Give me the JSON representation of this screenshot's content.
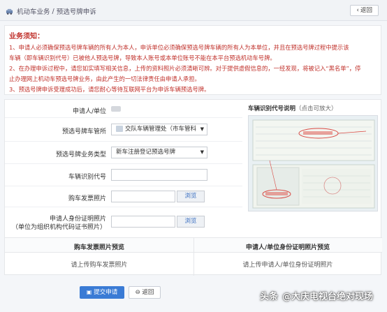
{
  "breadcrumb": {
    "section": "机动车业务",
    "separator": "/",
    "page": "预选号牌申诉"
  },
  "header": {
    "back_label": "返回"
  },
  "notice": {
    "title": "业务须知：",
    "lines": [
      "1、申请人必须确保预选号牌车辆的所有人为本人，申诉单位必须确保预选号牌车辆的所有人为本单位，并且在预选号牌过程中提示该",
      "车辆（即车辆识别代号）已被他人预选号牌，导致本人账号或本单位账号不能在本平台预选机动车号牌。",
      "2、在办理申诉过程中，请您如实填写相关信息，上传的资料照片必须清晰可辨。对于提供虚假信息的，一经发现，将被记入“黑名单”，停",
      "止办理网上机动车预选号牌业务，由此产生的一切法律责任由申请人承担。",
      "3、预选号牌申诉受理成功后，请您耐心等待互联网平台为申诉车辆预选号牌。"
    ]
  },
  "form": {
    "applicant_label": "申请人/单位",
    "vehicle_office_label": "预选号牌车管所",
    "vehicle_office_value": "交队车辆管理处（市车管科",
    "business_type_label": "预选号牌业务类型",
    "business_type_value": "新车注册登记预选号牌",
    "vin_label": "车辆识别代号",
    "invoice_photo_label": "购车发票照片",
    "id_photo_label": "申请人身份证明照片",
    "id_photo_sublabel": "（单位为组织机构代码证书照片）",
    "browse_label": "浏览"
  },
  "explain": {
    "title": "车辆识别代号说明",
    "hint": "（点击可放大）"
  },
  "preview": {
    "invoice_head": "购车发票照片预览",
    "id_head": "申请人/单位身份证明照片预览",
    "invoice_placeholder": "请上传购车发票照片",
    "id_placeholder": "请上传申请人/单位身份证明照片"
  },
  "actions": {
    "submit_label": "提交申请",
    "back_label": "返回"
  },
  "watermark": {
    "platform": "头条",
    "account": "@大庆电视台绝对现场"
  },
  "colors": {
    "accent": "#3a7bd5",
    "warning_red": "#c0312b"
  }
}
